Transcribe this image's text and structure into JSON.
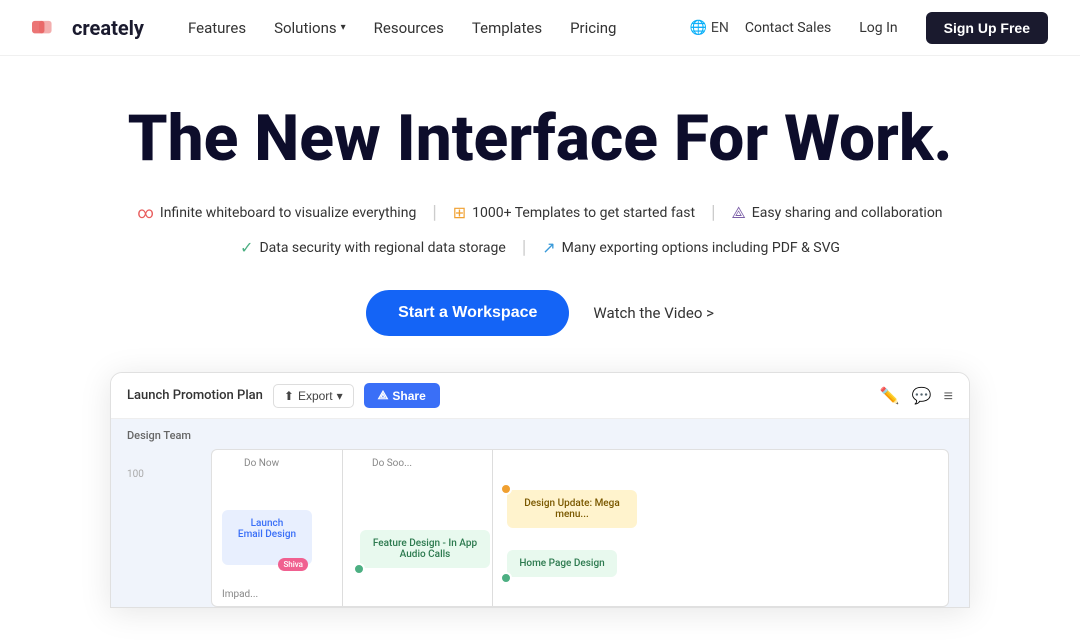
{
  "nav": {
    "logo_text": "creately",
    "links": [
      {
        "label": "Features",
        "has_dropdown": false
      },
      {
        "label": "Solutions",
        "has_dropdown": true
      },
      {
        "label": "Resources",
        "has_dropdown": false
      },
      {
        "label": "Templates",
        "has_dropdown": false
      },
      {
        "label": "Pricing",
        "has_dropdown": false
      }
    ],
    "lang": "EN",
    "contact_sales": "Contact Sales",
    "login": "Log In",
    "signup": "Sign Up Free"
  },
  "hero": {
    "title": "The New Interface For Work.",
    "features_row1": [
      {
        "icon": "infinite-icon",
        "text": "Infinite whiteboard to visualize everything"
      },
      {
        "icon": "templates-icon",
        "text": "1000+ Templates to get started fast"
      },
      {
        "icon": "share-icon",
        "text": "Easy sharing and collaboration"
      }
    ],
    "features_row2": [
      {
        "icon": "shield-icon",
        "text": "Data security with regional data storage"
      },
      {
        "icon": "export-icon",
        "text": "Many exporting options including PDF & SVG"
      }
    ],
    "cta_primary": "Start a Workspace",
    "cta_video": "Watch the Video >"
  },
  "screenshot": {
    "doc_name": "Launch Promotion Plan",
    "export_btn": "Export",
    "share_btn": "Share",
    "team_label": "Design Team",
    "col_do_now": "Do Now",
    "col_do_soon": "Do Soo...",
    "card_launch": "Launch\nEmail Design",
    "card_avatar": "Shiva",
    "card_feature": "Feature Design - In App Audio Calls",
    "card_homepage": "Home Page Design",
    "card_design_update": "Design Update: Mega menu...",
    "impact_label": "Impad...",
    "num_100": "100"
  },
  "colors": {
    "nav_signup_bg": "#1a1a2e",
    "cta_primary_bg": "#1464f6",
    "share_btn_bg": "#3a6ff7",
    "logo_accent": "#e85d5d"
  }
}
